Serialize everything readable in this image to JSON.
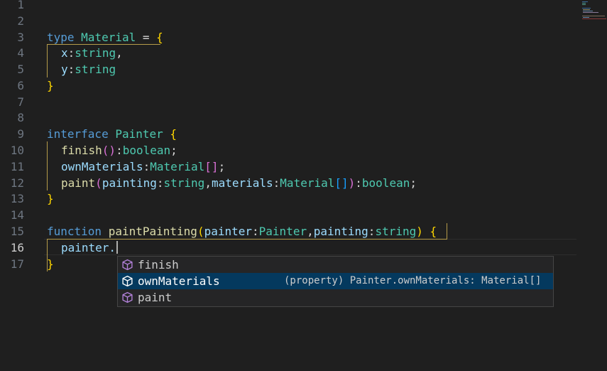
{
  "gutter": {
    "line_numbers": [
      "1",
      "2",
      "3",
      "4",
      "5",
      "6",
      "7",
      "8",
      "9",
      "10",
      "11",
      "12",
      "13",
      "14",
      "15",
      "16",
      "17"
    ],
    "active_line": "16"
  },
  "code": {
    "l3": {
      "kw": "type",
      "name": "Material",
      "eq": " = ",
      "brace": "{"
    },
    "l4": {
      "prop": "x",
      "colon": ":",
      "type": "string",
      "comma": ","
    },
    "l5": {
      "prop": "y",
      "colon": ":",
      "type": "string"
    },
    "l6": {
      "brace": "}"
    },
    "l9": {
      "kw": "interface",
      "name": "Painter",
      "brace": "{"
    },
    "l10": {
      "name": "finish",
      "parens": "()",
      "colon": ":",
      "type": "boolean",
      "semi": ";"
    },
    "l11": {
      "name": "ownMaterials",
      "colon": ":",
      "type": "Material",
      "brackets": "[]",
      "semi": ";"
    },
    "l12": {
      "name": "paint",
      "open": "(",
      "p1": "painting",
      "c1": ":",
      "t1": "string",
      "comma": ",",
      "p2": "materials",
      "c2": ":",
      "t2": "Material",
      "brackets": "[]",
      "close": ")",
      "c3": ":",
      "t3": "boolean",
      "semi": ";"
    },
    "l13": {
      "brace": "}"
    },
    "l15": {
      "kw": "function",
      "name": "paintPainting",
      "open": "(",
      "p1": "painter",
      "c1": ":",
      "t1": "Painter",
      "comma": ",",
      "p2": "painting",
      "c2": ":",
      "t2": "string",
      "close": ")",
      "brace": "{"
    },
    "l16": {
      "text": "painter."
    },
    "l17": {
      "brace": "}"
    }
  },
  "suggest": {
    "items": [
      {
        "label": "finish",
        "icon": "cube-icon",
        "detail": ""
      },
      {
        "label": "ownMaterials",
        "icon": "cube-icon",
        "detail": "(property) Painter.ownMaterials: Material[]"
      },
      {
        "label": "paint",
        "icon": "cube-icon",
        "detail": ""
      }
    ],
    "selected_index": 1
  },
  "colors": {
    "background": "#1f1f1f",
    "keyword": "#569cd6",
    "type": "#4ec9b0",
    "function": "#dcdcaa",
    "parameter": "#9cdcfe",
    "bracket_1": "#ffd700",
    "bracket_2": "#da70d6",
    "bracket_3": "#179fff",
    "selection": "#04395e",
    "icon": "#b180d7"
  }
}
